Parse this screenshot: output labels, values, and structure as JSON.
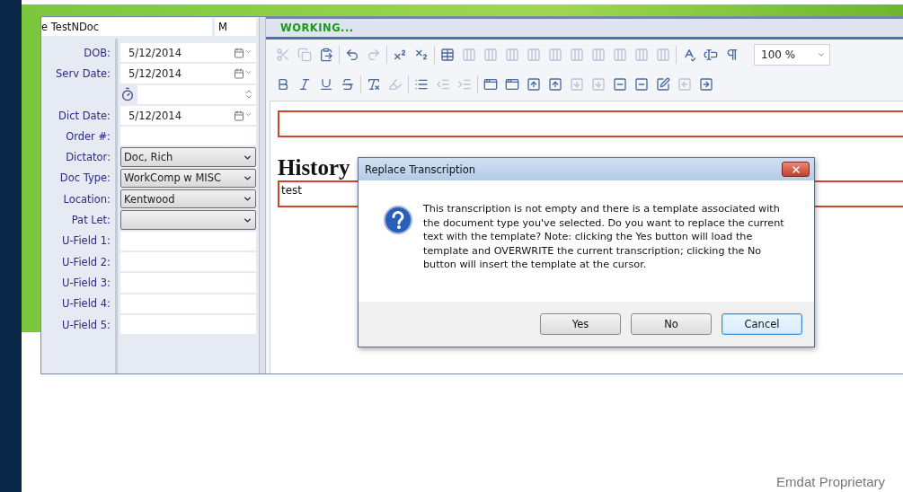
{
  "patient": {
    "name": "e TestNDoc",
    "sex": "M"
  },
  "fields": [
    {
      "label": "DOB:",
      "kind": "date",
      "value": "5/12/2014"
    },
    {
      "label": "Serv Date:",
      "kind": "date",
      "value": "5/12/2014"
    },
    {
      "kind": "time"
    },
    {
      "label": "Dict Date:",
      "kind": "date",
      "value": "5/12/2014"
    },
    {
      "label": "Order #:",
      "kind": "text"
    },
    {
      "label": "Dictator:",
      "kind": "select",
      "value": "Doc, Rich"
    },
    {
      "label": "Doc Type:",
      "kind": "select",
      "value": "WorkComp w MISC"
    },
    {
      "label": "Location:",
      "kind": "select",
      "value": "Kentwood"
    },
    {
      "label": "Pat Let:",
      "kind": "select"
    },
    {
      "label": "U-Field 1:",
      "kind": "text"
    },
    {
      "label": "U-Field 2:",
      "kind": "text"
    },
    {
      "label": "U-Field 3:",
      "kind": "text"
    },
    {
      "label": "U-Field 4:",
      "kind": "text"
    },
    {
      "label": "U-Field 5:",
      "kind": "text"
    }
  ],
  "status": "WORKING...",
  "toolbar_rows": [
    [
      {
        "kind": "cut",
        "disabled": true
      },
      {
        "kind": "copy",
        "disabled": true
      },
      {
        "kind": "paste",
        "disabled": false
      },
      {
        "kind": "sep"
      },
      {
        "kind": "undo",
        "disabled": false
      },
      {
        "kind": "redo",
        "disabled": true
      },
      {
        "kind": "sep"
      },
      {
        "kind": "superscript",
        "disabled": false
      },
      {
        "kind": "subscript",
        "disabled": false
      },
      {
        "kind": "sep"
      },
      {
        "kind": "table",
        "disabled": false
      },
      {
        "kind": "table-op",
        "disabled": true
      },
      {
        "kind": "table-op",
        "disabled": true
      },
      {
        "kind": "table-op",
        "disabled": true
      },
      {
        "kind": "table-op",
        "disabled": true
      },
      {
        "kind": "table-op",
        "disabled": true
      },
      {
        "kind": "table-op",
        "disabled": true
      },
      {
        "kind": "table-op",
        "disabled": true
      },
      {
        "kind": "table-op",
        "disabled": true
      },
      {
        "kind": "table-op",
        "disabled": true
      },
      {
        "kind": "table-op",
        "disabled": true
      },
      {
        "kind": "sep"
      },
      {
        "kind": "spellcheck",
        "disabled": false
      },
      {
        "kind": "field",
        "disabled": false
      },
      {
        "kind": "pilcrow",
        "disabled": false
      }
    ],
    [
      {
        "kind": "bold",
        "disabled": false
      },
      {
        "kind": "italic",
        "disabled": false
      },
      {
        "kind": "underline",
        "disabled": false
      },
      {
        "kind": "strike",
        "disabled": false
      },
      {
        "kind": "sep"
      },
      {
        "kind": "clear-format",
        "disabled": false
      },
      {
        "kind": "highlight",
        "disabled": true
      },
      {
        "kind": "sep"
      },
      {
        "kind": "list",
        "disabled": false
      },
      {
        "kind": "outdent",
        "disabled": true
      },
      {
        "kind": "indent",
        "disabled": true
      },
      {
        "kind": "sep"
      },
      {
        "kind": "section-add",
        "disabled": false
      },
      {
        "kind": "section-add",
        "disabled": false
      },
      {
        "kind": "section-up",
        "disabled": false
      },
      {
        "kind": "section-up",
        "disabled": false
      },
      {
        "kind": "section-down",
        "disabled": true
      },
      {
        "kind": "section-down",
        "disabled": true
      },
      {
        "kind": "section-remove",
        "disabled": false
      },
      {
        "kind": "section-remove",
        "disabled": false
      },
      {
        "kind": "section-edit",
        "disabled": false
      },
      {
        "kind": "section-back",
        "disabled": true
      },
      {
        "kind": "section-forward",
        "disabled": false
      }
    ]
  ],
  "zoom": "100 %",
  "document": {
    "heading": "History",
    "text": "test"
  },
  "dialog": {
    "title": "Replace Transcription",
    "message": "This transcription is not empty and there is a template associated with the document type you've selected. Do you want to replace the current text with the template? Note: clicking the Yes button will load the template and OVERWRITE the current transcription; clicking the No button will insert the template at the cursor.",
    "buttons": [
      {
        "label": "Yes",
        "default": false
      },
      {
        "label": "No",
        "default": false
      },
      {
        "label": "Cancel",
        "default": true
      }
    ]
  },
  "footer": "Emdat Proprietary"
}
